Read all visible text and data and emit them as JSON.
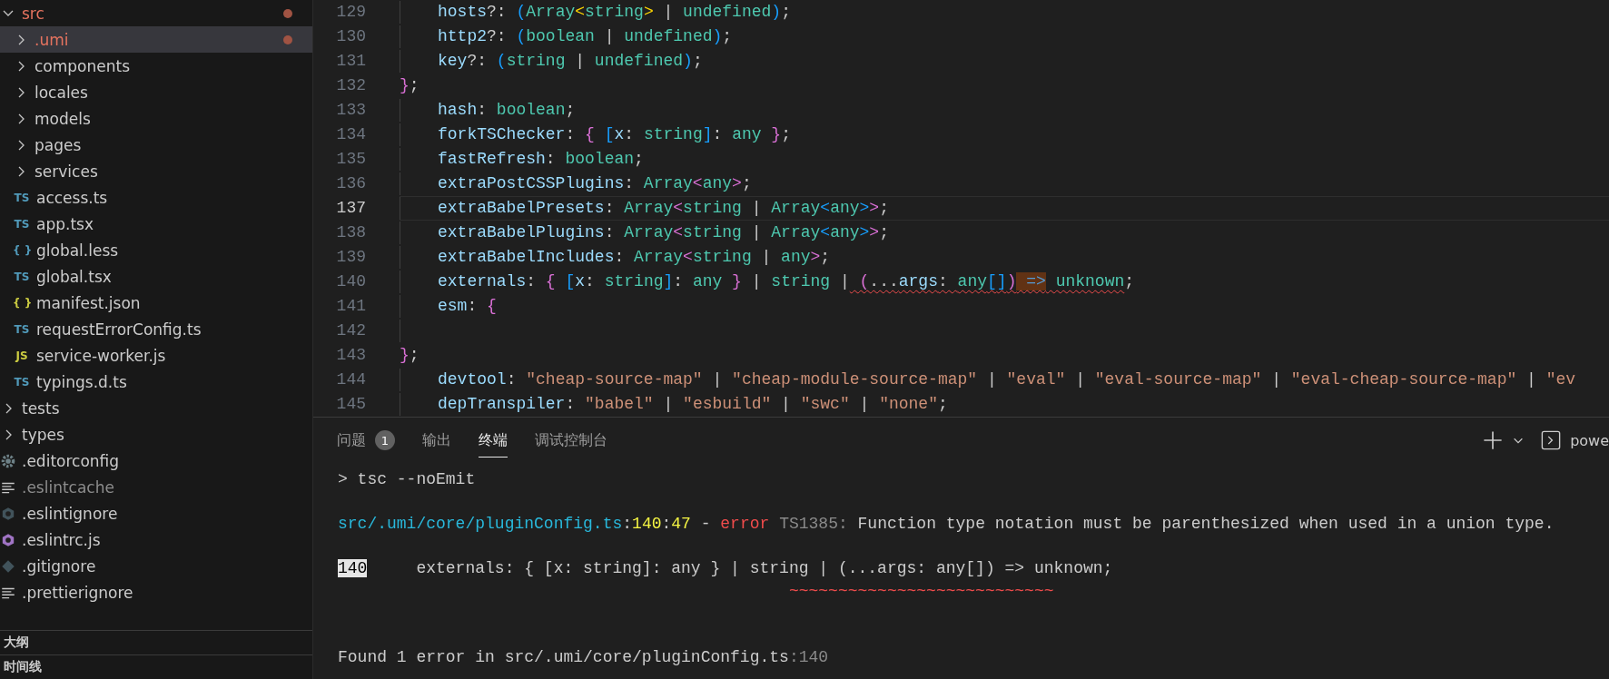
{
  "explorer": {
    "items": [
      {
        "name": "src",
        "kind": "folder",
        "expanded": true,
        "selected": false,
        "modified": true,
        "dimmed": false,
        "children": [
          {
            "name": ".umi",
            "kind": "folder",
            "expanded": false,
            "selected": true,
            "modified": true,
            "dimmed": false
          },
          {
            "name": "components",
            "kind": "folder",
            "expanded": false,
            "selected": false,
            "modified": false,
            "dimmed": false
          },
          {
            "name": "locales",
            "kind": "folder",
            "expanded": false,
            "selected": false,
            "modified": false,
            "dimmed": false
          },
          {
            "name": "models",
            "kind": "folder",
            "expanded": false,
            "selected": false,
            "modified": false,
            "dimmed": false
          },
          {
            "name": "pages",
            "kind": "folder",
            "expanded": false,
            "selected": false,
            "modified": false,
            "dimmed": false
          },
          {
            "name": "services",
            "kind": "folder",
            "expanded": false,
            "selected": false,
            "modified": false,
            "dimmed": false
          },
          {
            "name": "access.ts",
            "kind": "ts",
            "badge": "TS",
            "selected": false,
            "modified": false,
            "dimmed": false
          },
          {
            "name": "app.tsx",
            "kind": "ts",
            "badge": "TS",
            "selected": false,
            "modified": false,
            "dimmed": false
          },
          {
            "name": "global.less",
            "kind": "less",
            "badge": "{ }",
            "selected": false,
            "modified": false,
            "dimmed": false
          },
          {
            "name": "global.tsx",
            "kind": "ts",
            "badge": "TS",
            "selected": false,
            "modified": false,
            "dimmed": false
          },
          {
            "name": "manifest.json",
            "kind": "json",
            "badge": "{ }",
            "selected": false,
            "modified": false,
            "dimmed": false
          },
          {
            "name": "requestErrorConfig.ts",
            "kind": "ts",
            "badge": "TS",
            "selected": false,
            "modified": false,
            "dimmed": false
          },
          {
            "name": "service-worker.js",
            "kind": "js",
            "badge": "JS",
            "selected": false,
            "modified": false,
            "dimmed": false
          },
          {
            "name": "typings.d.ts",
            "kind": "ts",
            "badge": "TS",
            "selected": false,
            "modified": false,
            "dimmed": false
          }
        ]
      },
      {
        "name": "tests",
        "kind": "folder",
        "expanded": false,
        "selected": false,
        "modified": false,
        "dimmed": false
      },
      {
        "name": "types",
        "kind": "folder",
        "expanded": false,
        "selected": false,
        "modified": false,
        "dimmed": false
      },
      {
        "name": ".editorconfig",
        "kind": "config",
        "selected": false,
        "modified": false,
        "dimmed": false
      },
      {
        "name": ".eslintcache",
        "kind": "text",
        "selected": false,
        "modified": false,
        "dimmed": true
      },
      {
        "name": ".eslintignore",
        "kind": "ignore",
        "selected": false,
        "modified": false,
        "dimmed": false
      },
      {
        "name": ".eslintrc.js",
        "kind": "eslint",
        "selected": false,
        "modified": false,
        "dimmed": false
      },
      {
        "name": ".gitignore",
        "kind": "git",
        "selected": false,
        "modified": false,
        "dimmed": false
      },
      {
        "name": ".prettierignore",
        "kind": "text",
        "selected": false,
        "modified": false,
        "dimmed": false
      }
    ]
  },
  "outline": {
    "title": "大纲"
  },
  "timeline": {
    "title": "时间线"
  },
  "editor": {
    "lines": [
      {
        "number": "129",
        "indented": true,
        "current": false,
        "tokens": [
          {
            "text": "hosts",
            "kind": "prop"
          },
          {
            "text": "?: ",
            "kind": "punct"
          },
          {
            "text": "(",
            "kind": "b3"
          },
          {
            "text": "Array",
            "kind": "type"
          },
          {
            "text": "<",
            "kind": "b1"
          },
          {
            "text": "string",
            "kind": "type"
          },
          {
            "text": ">",
            "kind": "b1"
          },
          {
            "text": " | ",
            "kind": "punct"
          },
          {
            "text": "undefined",
            "kind": "type"
          },
          {
            "text": ")",
            "kind": "b3"
          },
          {
            "text": ";",
            "kind": "punct"
          }
        ]
      },
      {
        "number": "130",
        "indented": true,
        "current": false,
        "tokens": [
          {
            "text": "http2",
            "kind": "prop"
          },
          {
            "text": "?: ",
            "kind": "punct"
          },
          {
            "text": "(",
            "kind": "b3"
          },
          {
            "text": "boolean",
            "kind": "type"
          },
          {
            "text": " | ",
            "kind": "punct"
          },
          {
            "text": "undefined",
            "kind": "type"
          },
          {
            "text": ")",
            "kind": "b3"
          },
          {
            "text": ";",
            "kind": "punct"
          }
        ]
      },
      {
        "number": "131",
        "indented": true,
        "current": false,
        "tokens": [
          {
            "text": "key",
            "kind": "prop"
          },
          {
            "text": "?: ",
            "kind": "punct"
          },
          {
            "text": "(",
            "kind": "b3"
          },
          {
            "text": "string",
            "kind": "type"
          },
          {
            "text": " | ",
            "kind": "punct"
          },
          {
            "text": "undefined",
            "kind": "type"
          },
          {
            "text": ")",
            "kind": "b3"
          },
          {
            "text": ";",
            "kind": "punct"
          }
        ]
      },
      {
        "number": "132",
        "indented": false,
        "current": false,
        "tokens": [
          {
            "text": "}",
            "kind": "b2"
          },
          {
            "text": ";",
            "kind": "punct"
          }
        ]
      },
      {
        "number": "133",
        "indented": true,
        "current": false,
        "tokens": [
          {
            "text": "hash",
            "kind": "prop"
          },
          {
            "text": ": ",
            "kind": "punct"
          },
          {
            "text": "boolean",
            "kind": "type"
          },
          {
            "text": ";",
            "kind": "punct"
          }
        ]
      },
      {
        "number": "134",
        "indented": true,
        "current": false,
        "tokens": [
          {
            "text": "forkTSChecker",
            "kind": "prop"
          },
          {
            "text": ": ",
            "kind": "punct"
          },
          {
            "text": "{",
            "kind": "b2"
          },
          {
            "text": " [",
            "kind": "b3"
          },
          {
            "text": "x",
            "kind": "prop"
          },
          {
            "text": ": ",
            "kind": "punct"
          },
          {
            "text": "string",
            "kind": "type"
          },
          {
            "text": "]",
            "kind": "b3"
          },
          {
            "text": ": ",
            "kind": "punct"
          },
          {
            "text": "any",
            "kind": "type"
          },
          {
            "text": " }",
            "kind": "b2"
          },
          {
            "text": ";",
            "kind": "punct"
          }
        ]
      },
      {
        "number": "135",
        "indented": true,
        "current": false,
        "tokens": [
          {
            "text": "fastRefresh",
            "kind": "prop"
          },
          {
            "text": ": ",
            "kind": "punct"
          },
          {
            "text": "boolean",
            "kind": "type"
          },
          {
            "text": ";",
            "kind": "punct"
          }
        ]
      },
      {
        "number": "136",
        "indented": true,
        "current": false,
        "tokens": [
          {
            "text": "extraPostCSSPlugins",
            "kind": "prop"
          },
          {
            "text": ": ",
            "kind": "punct"
          },
          {
            "text": "Array",
            "kind": "type"
          },
          {
            "text": "<",
            "kind": "b2"
          },
          {
            "text": "any",
            "kind": "type"
          },
          {
            "text": ">",
            "kind": "b2"
          },
          {
            "text": ";",
            "kind": "punct"
          }
        ]
      },
      {
        "number": "137",
        "indented": true,
        "current": true,
        "tokens": [
          {
            "text": "extraBabelPresets",
            "kind": "prop"
          },
          {
            "text": ": ",
            "kind": "punct"
          },
          {
            "text": "Array",
            "kind": "type"
          },
          {
            "text": "<",
            "kind": "b2"
          },
          {
            "text": "string",
            "kind": "type"
          },
          {
            "text": " | ",
            "kind": "punct"
          },
          {
            "text": "Array",
            "kind": "type"
          },
          {
            "text": "<",
            "kind": "b3"
          },
          {
            "text": "any",
            "kind": "type"
          },
          {
            "text": ">",
            "kind": "b3"
          },
          {
            "text": ">",
            "kind": "b2"
          },
          {
            "text": ";",
            "kind": "punct"
          }
        ]
      },
      {
        "number": "138",
        "indented": true,
        "current": false,
        "tokens": [
          {
            "text": "extraBabelPlugins",
            "kind": "prop"
          },
          {
            "text": ": ",
            "kind": "punct"
          },
          {
            "text": "Array",
            "kind": "type"
          },
          {
            "text": "<",
            "kind": "b2"
          },
          {
            "text": "string",
            "kind": "type"
          },
          {
            "text": " | ",
            "kind": "punct"
          },
          {
            "text": "Array",
            "kind": "type"
          },
          {
            "text": "<",
            "kind": "b3"
          },
          {
            "text": "any",
            "kind": "type"
          },
          {
            "text": ">",
            "kind": "b3"
          },
          {
            "text": ">",
            "kind": "b2"
          },
          {
            "text": ";",
            "kind": "punct"
          }
        ]
      },
      {
        "number": "139",
        "indented": true,
        "current": false,
        "tokens": [
          {
            "text": "extraBabelIncludes",
            "kind": "prop"
          },
          {
            "text": ": ",
            "kind": "punct"
          },
          {
            "text": "Array",
            "kind": "type"
          },
          {
            "text": "<",
            "kind": "b2"
          },
          {
            "text": "string",
            "kind": "type"
          },
          {
            "text": " | ",
            "kind": "punct"
          },
          {
            "text": "any",
            "kind": "type"
          },
          {
            "text": ">",
            "kind": "b2"
          },
          {
            "text": ";",
            "kind": "punct"
          }
        ]
      },
      {
        "number": "140",
        "indented": true,
        "current": false,
        "tokens": [
          {
            "text": "externals",
            "kind": "prop",
            "squiggle": false,
            "highlight": false
          },
          {
            "text": ": ",
            "kind": "punct",
            "squiggle": false,
            "highlight": false
          },
          {
            "text": "{",
            "kind": "b2",
            "squiggle": false,
            "highlight": false
          },
          {
            "text": " [",
            "kind": "b3",
            "squiggle": false,
            "highlight": false
          },
          {
            "text": "x",
            "kind": "prop",
            "squiggle": false,
            "highlight": false
          },
          {
            "text": ": ",
            "kind": "punct",
            "squiggle": false,
            "highlight": false
          },
          {
            "text": "string",
            "kind": "type",
            "squiggle": false,
            "highlight": false
          },
          {
            "text": "]",
            "kind": "b3",
            "squiggle": false,
            "highlight": false
          },
          {
            "text": ": ",
            "kind": "punct",
            "squiggle": false,
            "highlight": false
          },
          {
            "text": "any",
            "kind": "type",
            "squiggle": false,
            "highlight": false
          },
          {
            "text": " }",
            "kind": "b2",
            "squiggle": false,
            "highlight": false
          },
          {
            "text": " | ",
            "kind": "punct",
            "squiggle": false,
            "highlight": false
          },
          {
            "text": "string",
            "kind": "type",
            "squiggle": false,
            "highlight": false
          },
          {
            "text": " |",
            "kind": "punct",
            "squiggle": false,
            "highlight": false
          },
          {
            "text": " (",
            "kind": "b2",
            "squiggle": true,
            "highlight": false
          },
          {
            "text": "...",
            "kind": "punct",
            "squiggle": true,
            "highlight": false
          },
          {
            "text": "args",
            "kind": "prop",
            "squiggle": true,
            "highlight": false
          },
          {
            "text": ": ",
            "kind": "punct",
            "squiggle": true,
            "highlight": false
          },
          {
            "text": "any",
            "kind": "type",
            "squiggle": true,
            "highlight": false
          },
          {
            "text": "[",
            "kind": "b3",
            "squiggle": true,
            "highlight": false
          },
          {
            "text": "]",
            "kind": "b3",
            "squiggle": true,
            "highlight": false
          },
          {
            "text": ")",
            "kind": "b2",
            "squiggle": true,
            "highlight": false
          },
          {
            "text": " =>",
            "kind": "kw",
            "squiggle": true,
            "highlight": true
          },
          {
            "text": " unknown",
            "kind": "type",
            "squiggle": true,
            "highlight": false
          },
          {
            "text": ";",
            "kind": "punct",
            "squiggle": false,
            "highlight": false
          }
        ]
      },
      {
        "number": "141",
        "indented": true,
        "current": false,
        "tokens": [
          {
            "text": "esm",
            "kind": "prop"
          },
          {
            "text": ": ",
            "kind": "punct"
          },
          {
            "text": "{",
            "kind": "b2"
          }
        ]
      },
      {
        "number": "142",
        "indented": true,
        "current": false
      },
      {
        "number": "143",
        "indented": false,
        "current": false,
        "tokens": [
          {
            "text": "}",
            "kind": "b2"
          },
          {
            "text": ";",
            "kind": "punct"
          }
        ]
      },
      {
        "number": "144",
        "indented": true,
        "current": false,
        "tokens": [
          {
            "text": "devtool",
            "kind": "prop"
          },
          {
            "text": ": ",
            "kind": "punct"
          },
          {
            "text": "\"cheap-source-map\"",
            "kind": "str"
          },
          {
            "text": " | ",
            "kind": "punct"
          },
          {
            "text": "\"cheap-module-source-map\"",
            "kind": "str"
          },
          {
            "text": " | ",
            "kind": "punct"
          },
          {
            "text": "\"eval\"",
            "kind": "str"
          },
          {
            "text": " | ",
            "kind": "punct"
          },
          {
            "text": "\"eval-source-map\"",
            "kind": "str"
          },
          {
            "text": " | ",
            "kind": "punct"
          },
          {
            "text": "\"eval-cheap-source-map\"",
            "kind": "str"
          },
          {
            "text": " | ",
            "kind": "punct"
          },
          {
            "text": "\"ev",
            "kind": "str"
          }
        ]
      },
      {
        "number": "145",
        "indented": true,
        "current": false,
        "tokens": [
          {
            "text": "depTranspiler",
            "kind": "prop"
          },
          {
            "text": ": ",
            "kind": "punct"
          },
          {
            "text": "\"babel\"",
            "kind": "str"
          },
          {
            "text": " | ",
            "kind": "punct"
          },
          {
            "text": "\"esbuild\"",
            "kind": "str"
          },
          {
            "text": " | ",
            "kind": "punct"
          },
          {
            "text": "\"swc\"",
            "kind": "str"
          },
          {
            "text": " | ",
            "kind": "punct"
          },
          {
            "text": "\"none\"",
            "kind": "str"
          },
          {
            "text": ";",
            "kind": "punct"
          }
        ]
      }
    ]
  },
  "panel": {
    "tabs": [
      {
        "label": "问题",
        "badge": "1",
        "selected": false
      },
      {
        "label": "输出",
        "selected": false
      },
      {
        "label": "终端",
        "selected": true
      },
      {
        "label": "调试控制台",
        "selected": false
      }
    ],
    "terminal_name": "powe",
    "terminal": [
      {
        "kind": "text",
        "segments": [
          {
            "text": "> tsc --noEmit",
            "kind": "plain"
          }
        ]
      },
      {
        "kind": "blank"
      },
      {
        "kind": "text",
        "segments": [
          {
            "text": "src/.umi/core/pluginConfig.ts",
            "kind": "path"
          },
          {
            "text": ":",
            "kind": "plain"
          },
          {
            "text": "140",
            "kind": "num"
          },
          {
            "text": ":",
            "kind": "plain"
          },
          {
            "text": "47",
            "kind": "num"
          },
          {
            "text": " - ",
            "kind": "plain"
          },
          {
            "text": "error",
            "kind": "err"
          },
          {
            "text": " TS1385:",
            "kind": "dim"
          },
          {
            "text": " Function type notation must be parenthesized when used in a union type.",
            "kind": "plain"
          }
        ]
      },
      {
        "kind": "blank"
      },
      {
        "kind": "text",
        "segments": [
          {
            "text": "140",
            "kind": "inverse"
          },
          {
            "text": "     externals: { [x: string]: any } | string | (...args: any[]) => unknown;",
            "kind": "plain"
          }
        ]
      },
      {
        "kind": "text",
        "segments": [
          {
            "text": "                                              ~~~~~~~~~~~~~~~~~~~~~~~~~~~",
            "kind": "squiggle"
          }
        ]
      },
      {
        "kind": "blank"
      },
      {
        "kind": "blank"
      },
      {
        "kind": "text",
        "segments": [
          {
            "text": "Found 1 error in src/.umi/core/pluginConfig.ts",
            "kind": "plain"
          },
          {
            "text": ":140",
            "kind": "dim"
          }
        ]
      }
    ]
  }
}
